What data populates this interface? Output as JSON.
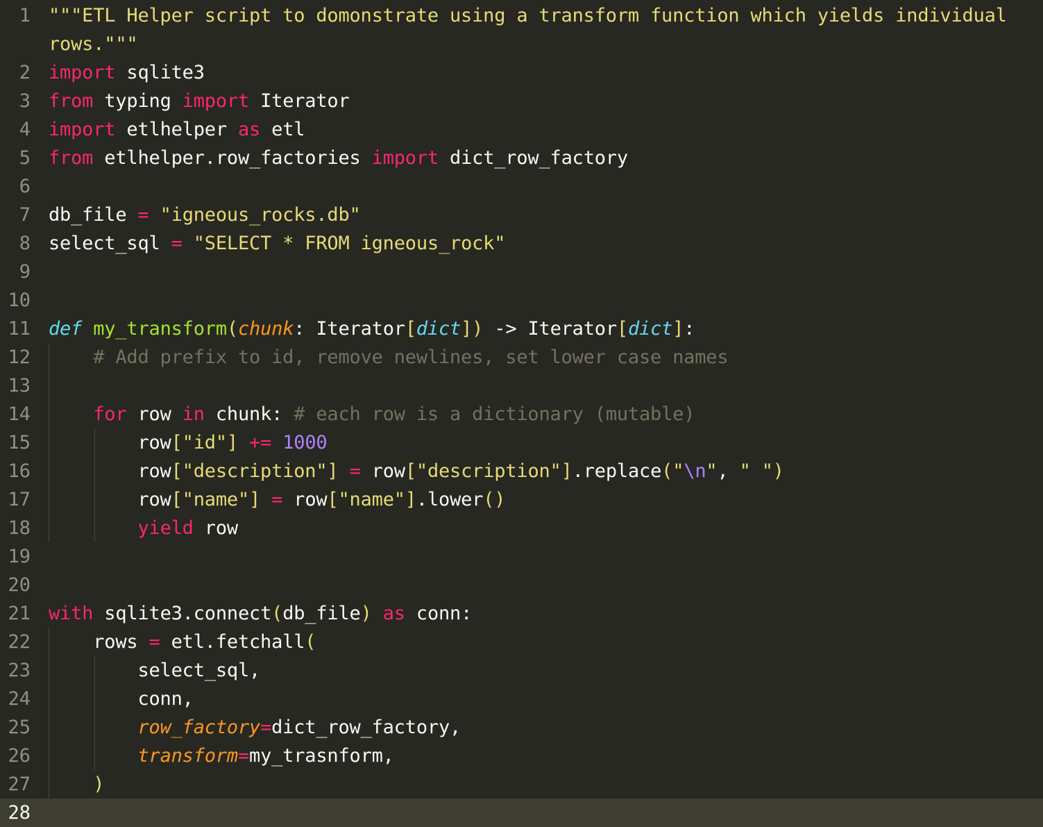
{
  "editor": {
    "lines": [
      {
        "n": "1",
        "tokens": [
          {
            "t": "\"\"\"ETL Helper script to domonstrate using a transform function which yields individual",
            "c": "str"
          }
        ]
      },
      {
        "n": "",
        "tokens": [
          {
            "t": "rows.\"\"\"",
            "c": "str"
          }
        ]
      },
      {
        "n": "2",
        "tokens": [
          {
            "t": "import",
            "c": "kw"
          },
          {
            "t": " sqlite3",
            "c": "plain"
          }
        ]
      },
      {
        "n": "3",
        "tokens": [
          {
            "t": "from",
            "c": "kw"
          },
          {
            "t": " typing ",
            "c": "plain"
          },
          {
            "t": "import",
            "c": "kw"
          },
          {
            "t": " Iterator",
            "c": "plain"
          }
        ]
      },
      {
        "n": "4",
        "tokens": [
          {
            "t": "import",
            "c": "kw"
          },
          {
            "t": " etlhelper ",
            "c": "plain"
          },
          {
            "t": "as",
            "c": "kw"
          },
          {
            "t": " etl",
            "c": "plain"
          }
        ]
      },
      {
        "n": "5",
        "tokens": [
          {
            "t": "from",
            "c": "kw"
          },
          {
            "t": " etlhelper.row_factories ",
            "c": "plain"
          },
          {
            "t": "import",
            "c": "kw"
          },
          {
            "t": " dict_row_factory",
            "c": "plain"
          }
        ]
      },
      {
        "n": "6",
        "tokens": []
      },
      {
        "n": "7",
        "tokens": [
          {
            "t": "db_file ",
            "c": "plain"
          },
          {
            "t": "=",
            "c": "op"
          },
          {
            "t": " ",
            "c": "plain"
          },
          {
            "t": "\"igneous_rocks.db\"",
            "c": "str"
          }
        ]
      },
      {
        "n": "8",
        "tokens": [
          {
            "t": "select_sql ",
            "c": "plain"
          },
          {
            "t": "=",
            "c": "op"
          },
          {
            "t": " ",
            "c": "plain"
          },
          {
            "t": "\"SELECT * FROM igneous_rock\"",
            "c": "str"
          }
        ]
      },
      {
        "n": "9",
        "tokens": []
      },
      {
        "n": "10",
        "tokens": []
      },
      {
        "n": "11",
        "tokens": [
          {
            "t": "def",
            "c": "def"
          },
          {
            "t": " ",
            "c": "plain"
          },
          {
            "t": "my_transform",
            "c": "fn"
          },
          {
            "t": "(",
            "c": "br"
          },
          {
            "t": "chunk",
            "c": "par"
          },
          {
            "t": ": Iterator",
            "c": "plain"
          },
          {
            "t": "[",
            "c": "br"
          },
          {
            "t": "dict",
            "c": "type"
          },
          {
            "t": "])",
            "c": "br"
          },
          {
            "t": " -> Iterator",
            "c": "plain"
          },
          {
            "t": "[",
            "c": "br"
          },
          {
            "t": "dict",
            "c": "type"
          },
          {
            "t": "]",
            "c": "br"
          },
          {
            "t": ":",
            "c": "plain"
          }
        ]
      },
      {
        "n": "12",
        "tokens": [
          {
            "t": "    ",
            "c": "plain"
          },
          {
            "t": "# Add prefix to id, remove newlines, set lower case names",
            "c": "com"
          }
        ]
      },
      {
        "n": "13",
        "tokens": []
      },
      {
        "n": "14",
        "tokens": [
          {
            "t": "    ",
            "c": "plain"
          },
          {
            "t": "for",
            "c": "kw"
          },
          {
            "t": " row ",
            "c": "plain"
          },
          {
            "t": "in",
            "c": "kw"
          },
          {
            "t": " chunk: ",
            "c": "plain"
          },
          {
            "t": "# each row is a dictionary (mutable)",
            "c": "com"
          }
        ]
      },
      {
        "n": "15",
        "tokens": [
          {
            "t": "        row",
            "c": "plain"
          },
          {
            "t": "[",
            "c": "br"
          },
          {
            "t": "\"id\"",
            "c": "str"
          },
          {
            "t": "]",
            "c": "br"
          },
          {
            "t": " ",
            "c": "plain"
          },
          {
            "t": "+=",
            "c": "op"
          },
          {
            "t": " ",
            "c": "plain"
          },
          {
            "t": "1000",
            "c": "num"
          }
        ]
      },
      {
        "n": "16",
        "tokens": [
          {
            "t": "        row",
            "c": "plain"
          },
          {
            "t": "[",
            "c": "br"
          },
          {
            "t": "\"description\"",
            "c": "str"
          },
          {
            "t": "]",
            "c": "br"
          },
          {
            "t": " ",
            "c": "plain"
          },
          {
            "t": "=",
            "c": "op"
          },
          {
            "t": " row",
            "c": "plain"
          },
          {
            "t": "[",
            "c": "br"
          },
          {
            "t": "\"description\"",
            "c": "str"
          },
          {
            "t": "]",
            "c": "br"
          },
          {
            "t": ".replace",
            "c": "plain"
          },
          {
            "t": "(",
            "c": "br"
          },
          {
            "t": "\"",
            "c": "str"
          },
          {
            "t": "\\n",
            "c": "esc"
          },
          {
            "t": "\"",
            "c": "str"
          },
          {
            "t": ", ",
            "c": "plain"
          },
          {
            "t": "\" \"",
            "c": "str"
          },
          {
            "t": ")",
            "c": "br"
          }
        ]
      },
      {
        "n": "17",
        "tokens": [
          {
            "t": "        row",
            "c": "plain"
          },
          {
            "t": "[",
            "c": "br"
          },
          {
            "t": "\"name\"",
            "c": "str"
          },
          {
            "t": "]",
            "c": "br"
          },
          {
            "t": " ",
            "c": "plain"
          },
          {
            "t": "=",
            "c": "op"
          },
          {
            "t": " row",
            "c": "plain"
          },
          {
            "t": "[",
            "c": "br"
          },
          {
            "t": "\"name\"",
            "c": "str"
          },
          {
            "t": "]",
            "c": "br"
          },
          {
            "t": ".lower",
            "c": "plain"
          },
          {
            "t": "()",
            "c": "br"
          }
        ]
      },
      {
        "n": "18",
        "tokens": [
          {
            "t": "        ",
            "c": "plain"
          },
          {
            "t": "yield",
            "c": "kw"
          },
          {
            "t": " row",
            "c": "plain"
          }
        ]
      },
      {
        "n": "19",
        "tokens": []
      },
      {
        "n": "20",
        "tokens": []
      },
      {
        "n": "21",
        "tokens": [
          {
            "t": "with",
            "c": "kw"
          },
          {
            "t": " sqlite3.connect",
            "c": "plain"
          },
          {
            "t": "(",
            "c": "br"
          },
          {
            "t": "db_file",
            "c": "plain"
          },
          {
            "t": ")",
            "c": "br"
          },
          {
            "t": " ",
            "c": "plain"
          },
          {
            "t": "as",
            "c": "kw"
          },
          {
            "t": " conn:",
            "c": "plain"
          }
        ]
      },
      {
        "n": "22",
        "tokens": [
          {
            "t": "    rows ",
            "c": "plain"
          },
          {
            "t": "=",
            "c": "op"
          },
          {
            "t": " etl.fetchall",
            "c": "plain"
          },
          {
            "t": "(",
            "c": "br"
          }
        ]
      },
      {
        "n": "23",
        "tokens": [
          {
            "t": "        select_sql,",
            "c": "plain"
          }
        ]
      },
      {
        "n": "24",
        "tokens": [
          {
            "t": "        conn,",
            "c": "plain"
          }
        ]
      },
      {
        "n": "25",
        "tokens": [
          {
            "t": "        ",
            "c": "plain"
          },
          {
            "t": "row_factory",
            "c": "par"
          },
          {
            "t": "=",
            "c": "op"
          },
          {
            "t": "dict_row_factory,",
            "c": "plain"
          }
        ]
      },
      {
        "n": "26",
        "tokens": [
          {
            "t": "        ",
            "c": "plain"
          },
          {
            "t": "transform",
            "c": "par"
          },
          {
            "t": "=",
            "c": "op"
          },
          {
            "t": "my_trasnform,",
            "c": "plain"
          }
        ]
      },
      {
        "n": "27",
        "tokens": [
          {
            "t": "    ",
            "c": "plain"
          },
          {
            "t": ")",
            "c": "br"
          }
        ]
      },
      {
        "n": "28",
        "tokens": [],
        "current": true
      }
    ]
  },
  "colors": {
    "background": "#272822",
    "current_line": "#3e3d32",
    "string": "#e6db74",
    "keyword": "#f92672",
    "function": "#a6e22e",
    "parameter": "#fd971f",
    "type": "#66d9ef",
    "comment": "#75715e",
    "number": "#ae81ff"
  }
}
